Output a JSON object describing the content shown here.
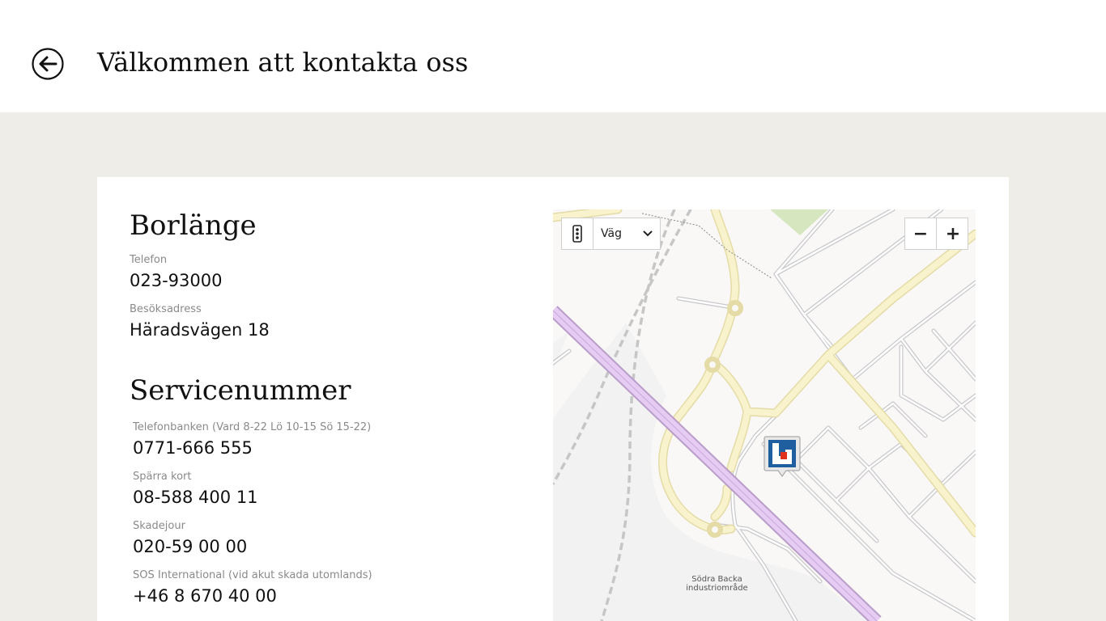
{
  "header": {
    "title": "Välkommen att kontakta oss"
  },
  "office": {
    "name": "Borlänge",
    "phone_label": "Telefon",
    "phone_value": "023-93000",
    "address_label": "Besöksadress",
    "address_value": "Häradsvägen 18"
  },
  "service": {
    "title": "Servicenummer",
    "items": [
      {
        "label": "Telefonbanken (Vard 8-22 Lö 10-15 Sö 15-22)",
        "value": "0771-666 555"
      },
      {
        "label": "Spärra kort",
        "value": "08-588 400 11"
      },
      {
        "label": "Skadejour",
        "value": "020-59 00 00"
      },
      {
        "label": "SOS International (vid akut skada utomlands)",
        "value": "+46 8 670 40 00"
      }
    ]
  },
  "map": {
    "style_selected": "Väg",
    "zoom_out": "−",
    "zoom_in": "+",
    "place_label_line1": "Södra Backa",
    "place_label_line2": "industriområde",
    "icons": [
      "back-arrow-icon",
      "traffic-icon",
      "chevron-down-icon",
      "minus-icon",
      "plus-icon",
      "bank-pin-icon"
    ]
  },
  "colors": {
    "background": "#efede8",
    "road_major": "#f7f1c6",
    "road_border": "#e6ddaa",
    "railway": "#d9b8ea",
    "pin_blue": "#1f5fa0",
    "pin_red": "#e0301e"
  }
}
